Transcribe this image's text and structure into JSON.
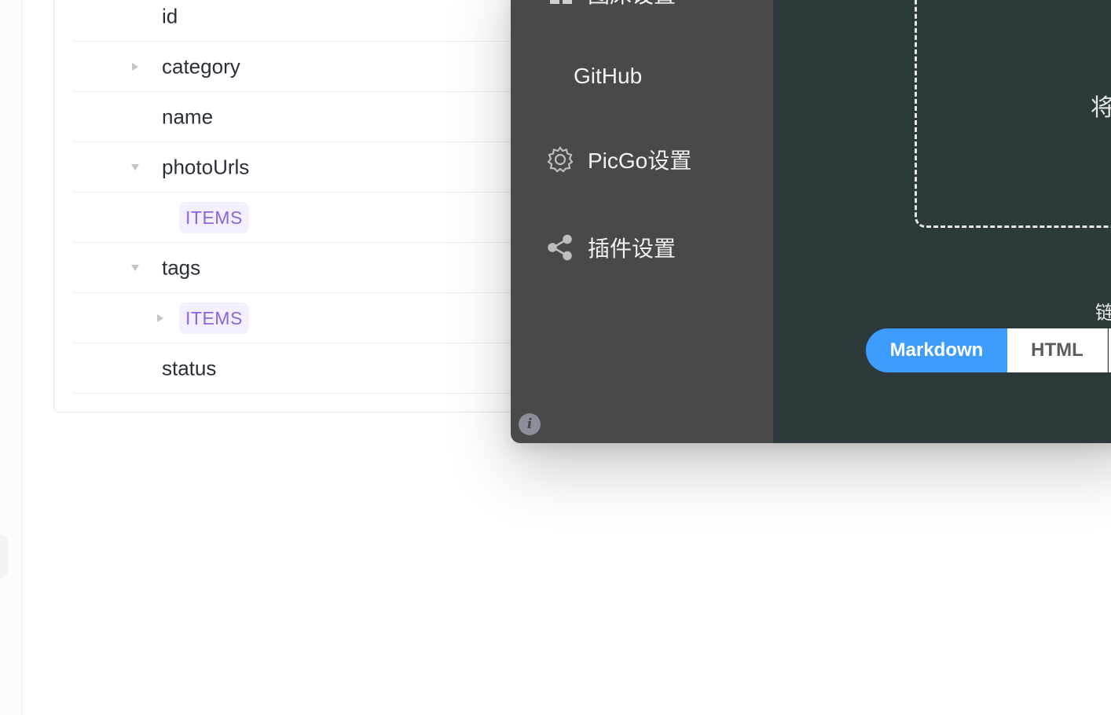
{
  "schema": {
    "rows": [
      {
        "name": "id",
        "caret": "none",
        "indent": 0
      },
      {
        "name": "category",
        "caret": "right",
        "indent": 0
      },
      {
        "name": "name",
        "caret": "none",
        "indent": 0
      },
      {
        "name": "photoUrls",
        "caret": "down",
        "indent": 0
      },
      {
        "badge": "ITEMS",
        "caret": "none",
        "indent": 1
      },
      {
        "name": "tags",
        "caret": "down",
        "indent": 0
      },
      {
        "badge": "ITEMS",
        "caret": "right",
        "indent": 1
      },
      {
        "name": "status",
        "caret": "none",
        "indent": 0
      }
    ]
  },
  "picgo": {
    "menu": {
      "cut_top_label": "图床设置",
      "github_label": "GitHub",
      "picgo_settings_label": "PicGo设置",
      "plugin_settings_label": "插件设置"
    },
    "upload": {
      "dropzone_text": "将",
      "format_label": "链"
    },
    "link_formats": {
      "markdown": "Markdown",
      "html": "HTML",
      "active": "Markdown"
    },
    "info_glyph": "i",
    "colors": {
      "sidebar_bg": "#494949",
      "main_bg": "#2d3a3b",
      "accent": "#3f9cff",
      "badge_bg": "#f3efff",
      "badge_text": "#8b66d9"
    }
  }
}
